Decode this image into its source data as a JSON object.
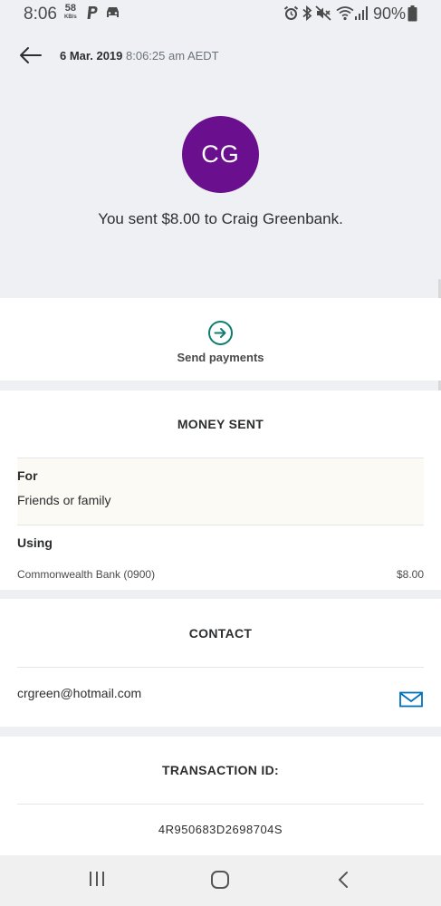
{
  "status_bar": {
    "time": "8:06",
    "net_speed_value": "58",
    "net_speed_unit": "KB/s",
    "battery": "90%",
    "icons": [
      "paypal-icon",
      "car-icon",
      "alarm-icon",
      "bluetooth-icon",
      "mute-icon",
      "wifi-icon",
      "signal-icon",
      "battery-icon"
    ]
  },
  "header": {
    "date": "6 Mar. 2019",
    "time": "8:06:25 am AEDT"
  },
  "recipient": {
    "initials": "CG",
    "avatar_color": "#6a0f8e",
    "summary": "You sent $8.00 to Craig Greenbank."
  },
  "action": {
    "label": "Send payments",
    "accent_color": "#0e7e6f"
  },
  "money_sent": {
    "title": "MONEY SENT",
    "for_label": "For",
    "for_value": "Friends or family",
    "using_label": "Using",
    "source": "Commonwealth Bank (0900)",
    "amount": "$8.00"
  },
  "contact": {
    "title": "CONTACT",
    "email": "crgreen@hotmail.com",
    "mail_icon_color": "#0070ba"
  },
  "transaction": {
    "title": "TRANSACTION ID:",
    "id": "4R950683D2698704S"
  },
  "nav_bar": {
    "buttons": [
      "recent-apps-icon",
      "home-icon",
      "back-icon"
    ]
  }
}
